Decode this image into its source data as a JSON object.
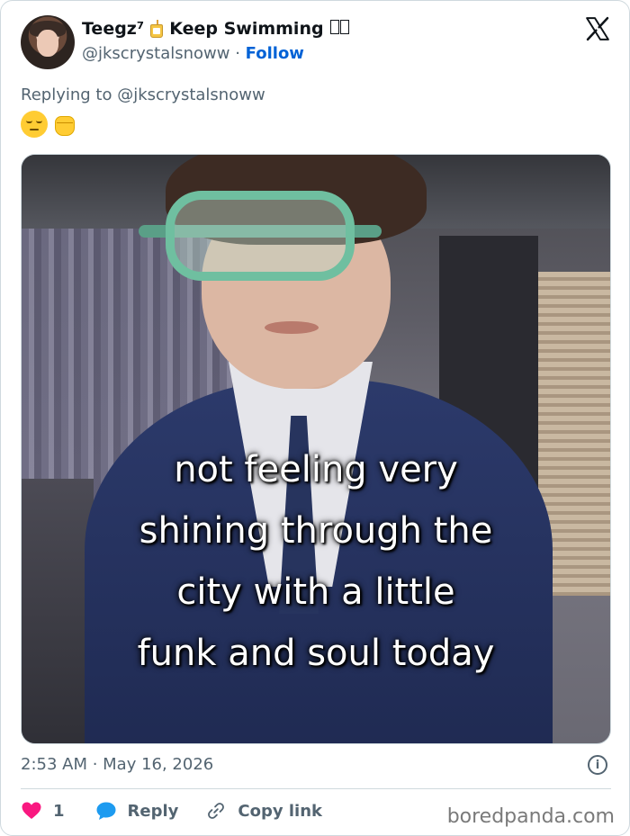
{
  "author": {
    "display_name": "Teegz⁷",
    "name_suffix": "Keep Swimming",
    "handle": "@jkscrystalsnoww",
    "separator": "·",
    "follow_label": "Follow"
  },
  "reply_context": "Replying to @jkscrystalsnoww",
  "media": {
    "caption_lines": [
      "not feeling very",
      "shining through the",
      "city with a little",
      "funk and soul today"
    ]
  },
  "timestamp": "2:53 AM · May 16, 2026",
  "actions": {
    "like_count": "1",
    "reply_label": "Reply",
    "copy_link_label": "Copy link"
  },
  "watermark": "boredpanda.com",
  "colors": {
    "accent": "#0062d6",
    "heart": "#f91880",
    "reply_bubble": "#1d9bf0",
    "muted_text": "#536471"
  },
  "icons": [
    "x-logo-icon",
    "juice-box-icon",
    "pensive-face-icon",
    "raised-fist-icon",
    "info-icon",
    "heart-icon",
    "reply-bubble-icon",
    "link-icon"
  ]
}
